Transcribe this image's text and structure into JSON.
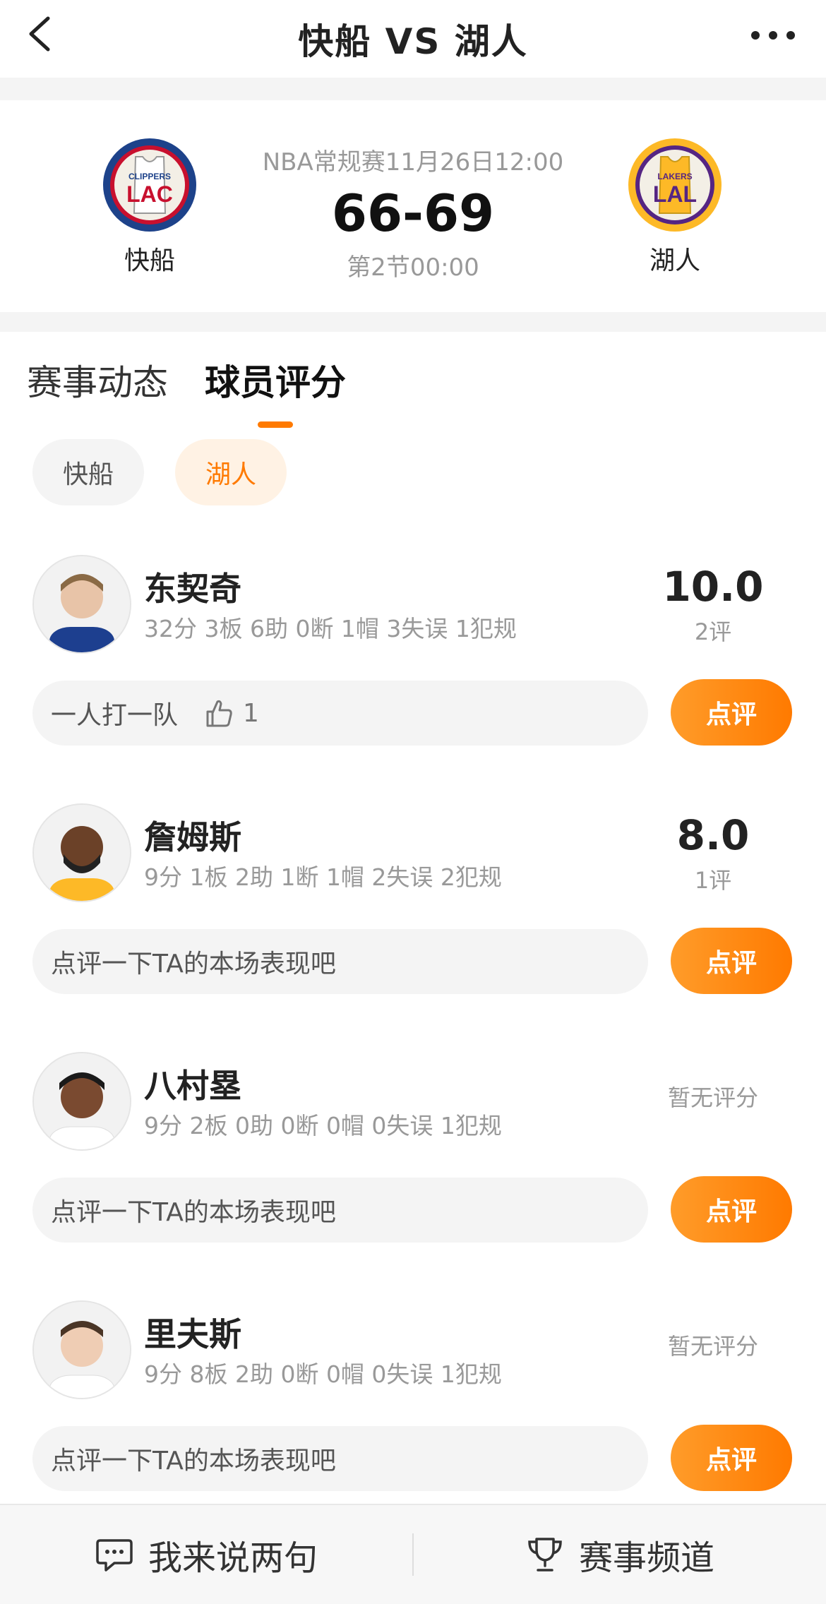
{
  "header": {
    "title": "快船 VS 湖人",
    "back_icon": "chevron-left-icon",
    "more_icon": "more-dots-icon"
  },
  "match": {
    "home": {
      "name": "快船",
      "logo_text": "LAC",
      "logo_sub": "CLIPPERS",
      "color": "#c8102e",
      "ring": "#1d428a"
    },
    "away": {
      "name": "湖人",
      "logo_text": "LAL",
      "logo_sub": "LAKERS",
      "color": "#552583",
      "ring": "#fdb927"
    },
    "info": "NBA常规赛11月26日12:00",
    "score": "66-69",
    "period": "第2节00:00"
  },
  "tabs": [
    {
      "label": "赛事动态",
      "active": false
    },
    {
      "label": "球员评分",
      "active": true
    }
  ],
  "team_chips": [
    {
      "label": "快船",
      "active": false
    },
    {
      "label": "湖人",
      "active": true
    }
  ],
  "players": [
    {
      "name": "东契奇",
      "stats": "32分 3板 6助 0断 1帽 3失误 1犯规",
      "rating": "10.0",
      "rating_count": "2评",
      "comment": "一人打一队",
      "likes": "1",
      "button": "点评"
    },
    {
      "name": "詹姆斯",
      "stats": "9分 1板 2助 1断 1帽 2失误 2犯规",
      "rating": "8.0",
      "rating_count": "1评",
      "comment": "点评一下TA的本场表现吧",
      "button": "点评"
    },
    {
      "name": "八村塁",
      "stats": "9分 2板 0助 0断 0帽 0失误 1犯规",
      "no_rating": "暂无评分",
      "comment": "点评一下TA的本场表现吧",
      "button": "点评"
    },
    {
      "name": "里夫斯",
      "stats": "9分 8板 2助 0断 0帽 0失误 1犯规",
      "no_rating": "暂无评分",
      "comment": "点评一下TA的本场表现吧",
      "button": "点评"
    }
  ],
  "bottom": {
    "comment_label": "我来说两句",
    "comment_icon": "chat-icon",
    "channel_label": "赛事频道",
    "channel_icon": "trophy-icon"
  },
  "colors": {
    "accent": "#ff7a00",
    "chip_active_bg": "#fff2e4"
  }
}
